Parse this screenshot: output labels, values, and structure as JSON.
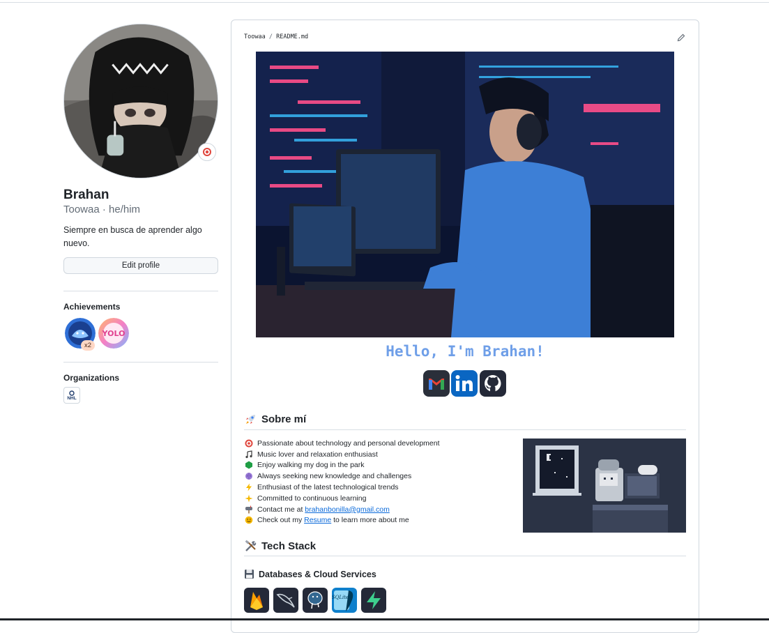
{
  "profile": {
    "name": "Brahan",
    "nickname": "Toowaa · he/him",
    "bio": "Siempre en busca de aprender algo nuevo.",
    "edit_button": "Edit profile",
    "achievements_title": "Achievements",
    "achievement_count": "x2",
    "organizations_title": "Organizations",
    "org_label": "NHL"
  },
  "readme": {
    "breadcrumb_user": "Toowaa",
    "breadcrumb_sep": "/",
    "breadcrumb_file": "README.md",
    "hello": "Hello, I'm Brahan!",
    "about_title": "Sobre mí",
    "about_items": [
      {
        "icon": "target-icon",
        "text": "Passionate about technology and personal development"
      },
      {
        "icon": "music-note-icon",
        "text": "Music lover and relaxation enthusiast"
      },
      {
        "icon": "paw-icon",
        "text": "Enjoy walking my dog in the park"
      },
      {
        "icon": "brain-icon",
        "text": "Always seeking new knowledge and challenges"
      },
      {
        "icon": "lightning-icon",
        "text": "Enthusiast of the latest technological trends"
      },
      {
        "icon": "sparkle-icon",
        "text": "Committed to continuous learning"
      },
      {
        "icon": "mailbox-icon",
        "text": "Contact me at ",
        "link": "brahanbonilla@gmail.com"
      },
      {
        "icon": "smile-icon",
        "text": "Check out my ",
        "link": "Resume",
        "after": " to learn more about me"
      }
    ],
    "tech_title": "Tech Stack",
    "db_title": "Databases & Cloud Services",
    "tech_icons": [
      "firebase-icon",
      "mysql-icon",
      "postgresql-icon",
      "sqlite-icon",
      "supabase-icon"
    ],
    "social_icons": [
      "gmail-icon",
      "linkedin-icon",
      "github-icon"
    ],
    "sqlite_label": "SQLite"
  },
  "colors": {
    "accent_link": "#0969da",
    "hello_text": "#6f9fe8",
    "border": "#d0d7de"
  }
}
